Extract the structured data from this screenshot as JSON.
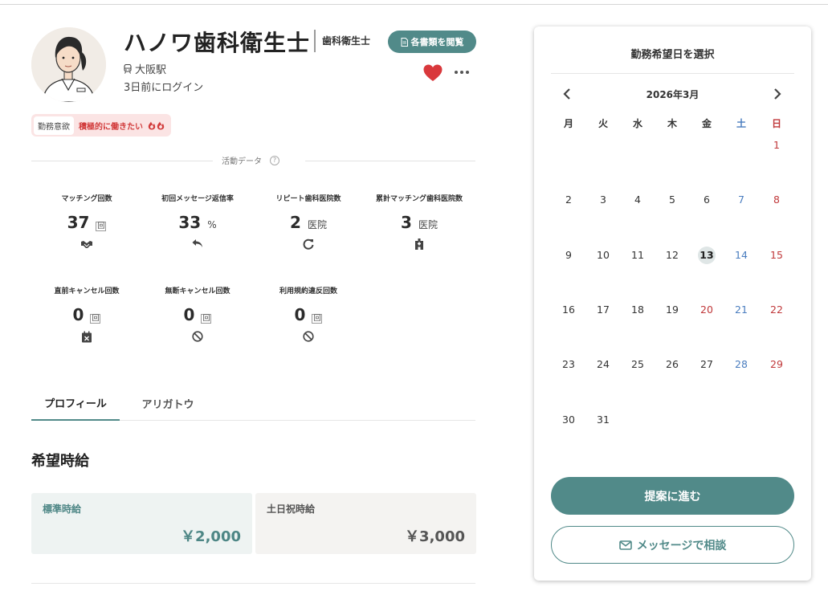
{
  "profile": {
    "name": "ハノワ歯科衛生士",
    "job": "歯科衛生士",
    "station": "大阪駅",
    "last_login": "3日前にログイン",
    "docs_button": "各書類を閲覧",
    "motivation_tag": "勤務意欲",
    "motivation_value": "積極的に働きたい"
  },
  "activity": {
    "title": "活動データ",
    "help": "?",
    "stats": [
      {
        "label": "マッチング回数",
        "value": "37",
        "unit": "回"
      },
      {
        "label": "初回メッセージ返信率",
        "value": "33",
        "unit": "%"
      },
      {
        "label": "リピート歯科医院数",
        "value": "2",
        "unit": "医院"
      },
      {
        "label": "累計マッチング歯科医院数",
        "value": "3",
        "unit": "医院"
      },
      {
        "label": "直前キャンセル回数",
        "value": "0",
        "unit": "回"
      },
      {
        "label": "無断キャンセル回数",
        "value": "0",
        "unit": "回"
      },
      {
        "label": "利用規約違反回数",
        "value": "0",
        "unit": "回"
      }
    ]
  },
  "tabs": [
    {
      "label": "プロフィール",
      "active": true
    },
    {
      "label": "アリガトウ",
      "active": false
    }
  ],
  "wage": {
    "title": "希望時給",
    "standard_label": "標準時給",
    "standard_value": "￥2,000",
    "holiday_label": "土日祝時給",
    "holiday_value": "￥3,000"
  },
  "calendar": {
    "title": "勤務希望日を選択",
    "month": "2026年3月",
    "weekdays": [
      "月",
      "火",
      "水",
      "木",
      "金",
      "土",
      "日"
    ],
    "today": "13",
    "holidays": [
      "20"
    ],
    "weeks": [
      [
        "",
        "",
        "",
        "",
        "",
        "",
        "1"
      ],
      [
        "2",
        "3",
        "4",
        "5",
        "6",
        "7",
        "8"
      ],
      [
        "9",
        "10",
        "11",
        "12",
        "13",
        "14",
        "15"
      ],
      [
        "16",
        "17",
        "18",
        "19",
        "20",
        "21",
        "22"
      ],
      [
        "23",
        "24",
        "25",
        "26",
        "27",
        "28",
        "29"
      ],
      [
        "30",
        "31",
        "",
        "",
        "",
        "",
        ""
      ]
    ]
  },
  "actions": {
    "propose": "提案に進む",
    "message": "メッセージで相談"
  },
  "colors": {
    "accent": "#518a89",
    "heart": "#d9383c",
    "saturday": "#4a7dbf",
    "sunday": "#c0383a"
  }
}
